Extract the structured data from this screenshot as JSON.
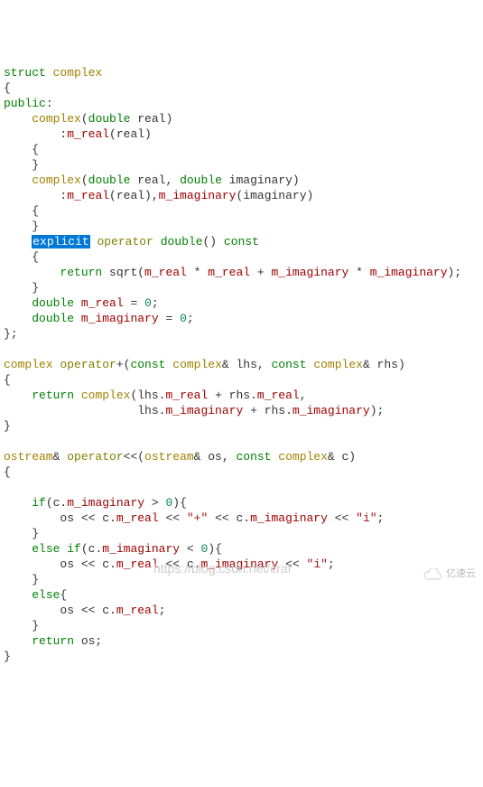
{
  "code": {
    "l01_struct": "struct",
    "l01_complex": "complex",
    "l02_brace": "{",
    "l03_public": "public",
    "l03_colon": ":",
    "l04_complex": "complex",
    "l04_lp": "(",
    "l04_double": "double",
    "l04_real": " real)",
    "l05_colon": ":",
    "l05_mreal": "m_real",
    "l05_rest": "(real)",
    "l06_brace": "{",
    "l07_brace": "}",
    "l08_complex": "complex",
    "l08_lp": "(",
    "l08_double1": "double",
    "l08_real": " real, ",
    "l08_double2": "double",
    "l08_imaginary": " imaginary)",
    "l09_colon": ":",
    "l09_mreal": "m_real",
    "l09_paren1": "(real),",
    "l09_mimag": "m_imaginary",
    "l09_paren2": "(imaginary)",
    "l10_brace": "{",
    "l11_brace": "}",
    "l12_explicit": "explicit",
    "l12_sp": " ",
    "l12_operator": "operator",
    "l12_sp2": " ",
    "l12_double": "double",
    "l12_paren": "() ",
    "l12_const": "const",
    "l13_brace": "{",
    "l14_return": "return",
    "l14_sqrt": " sqrt(",
    "l14_mr1": "m_real",
    "l14_mul1": " * ",
    "l14_mr2": "m_real",
    "l14_plus": " + ",
    "l14_mi1": "m_imaginary",
    "l14_mul2": " * ",
    "l14_mi2": "m_imaginary",
    "l14_end": ");",
    "l15_brace": "}",
    "l16_double": "double",
    "l16_sp": " ",
    "l16_mreal": "m_real",
    "l16_eq": " = ",
    "l16_zero": "0",
    "l16_semi": ";",
    "l17_double": "double",
    "l17_sp": " ",
    "l17_mimag": "m_imaginary",
    "l17_eq": " = ",
    "l17_zero": "0",
    "l17_semi": ";",
    "l18_end": "};",
    "l20_complex": "complex",
    "l20_sp": " ",
    "l20_operator": "operator",
    "l20_plus": "+(",
    "l20_const1": "const",
    "l20_sp2": " ",
    "l20_complex1": "complex",
    "l20_lhs": "& lhs, ",
    "l20_const2": "const",
    "l20_sp3": " ",
    "l20_complex2": "complex",
    "l20_rhs": "& rhs)",
    "l21_brace": "{",
    "l22_return": "return",
    "l22_sp": " ",
    "l22_complex": "complex",
    "l22_lhs": "(lhs.",
    "l22_mr1": "m_real",
    "l22_plus": " + rhs.",
    "l22_mr2": "m_real",
    "l22_comma": ",",
    "l23_lhs": "lhs.",
    "l23_mi1": "m_imaginary",
    "l23_plus": " + rhs.",
    "l23_mi2": "m_imaginary",
    "l23_end": ");",
    "l24_brace": "}",
    "l26_ostream": "ostream",
    "l26_amp": "& ",
    "l26_operator": "operator",
    "l26_shift": "<<(",
    "l26_ostream2": "ostream",
    "l26_os": "& os, ",
    "l26_const": "const",
    "l26_sp": " ",
    "l26_complex": "complex",
    "l26_c": "& c)",
    "l27_brace": "{",
    "l29_if": "if",
    "l29_cond": "(c.",
    "l29_mimag": "m_imaginary",
    "l29_gt": " > ",
    "l29_zero": "0",
    "l29_brace": "){",
    "l30_os": "os << c.",
    "l30_mreal": "m_real",
    "l30_shift": " << ",
    "l30_plus": "\"+\"",
    "l30_shift2": " << c.",
    "l30_mimag": "m_imaginary",
    "l30_shift3": " << ",
    "l30_i": "\"i\"",
    "l30_semi": ";",
    "l31_brace": "}",
    "l32_else": "else",
    "l32_sp": " ",
    "l32_if": "if",
    "l32_cond": "(c.",
    "l32_mimag": "m_imaginary",
    "l32_lt": " < ",
    "l32_zero": "0",
    "l32_brace": "){",
    "l33_os": "os << c.",
    "l33_mreal": "m_real",
    "l33_shift": " << c.",
    "l33_mimag": "m_imaginary",
    "l33_shift2": " << ",
    "l33_i": "\"i\"",
    "l33_semi": ";",
    "l34_brace": "}",
    "l35_else": "else",
    "l35_brace": "{",
    "l36_os": "os << c.",
    "l36_mreal": "m_real",
    "l36_semi": ";",
    "l37_brace": "}",
    "l38_return": "return",
    "l38_os": " os;",
    "l39_brace": "}"
  },
  "watermark": "https://blog.csdn.net/craf",
  "logo_text": "亿速云"
}
